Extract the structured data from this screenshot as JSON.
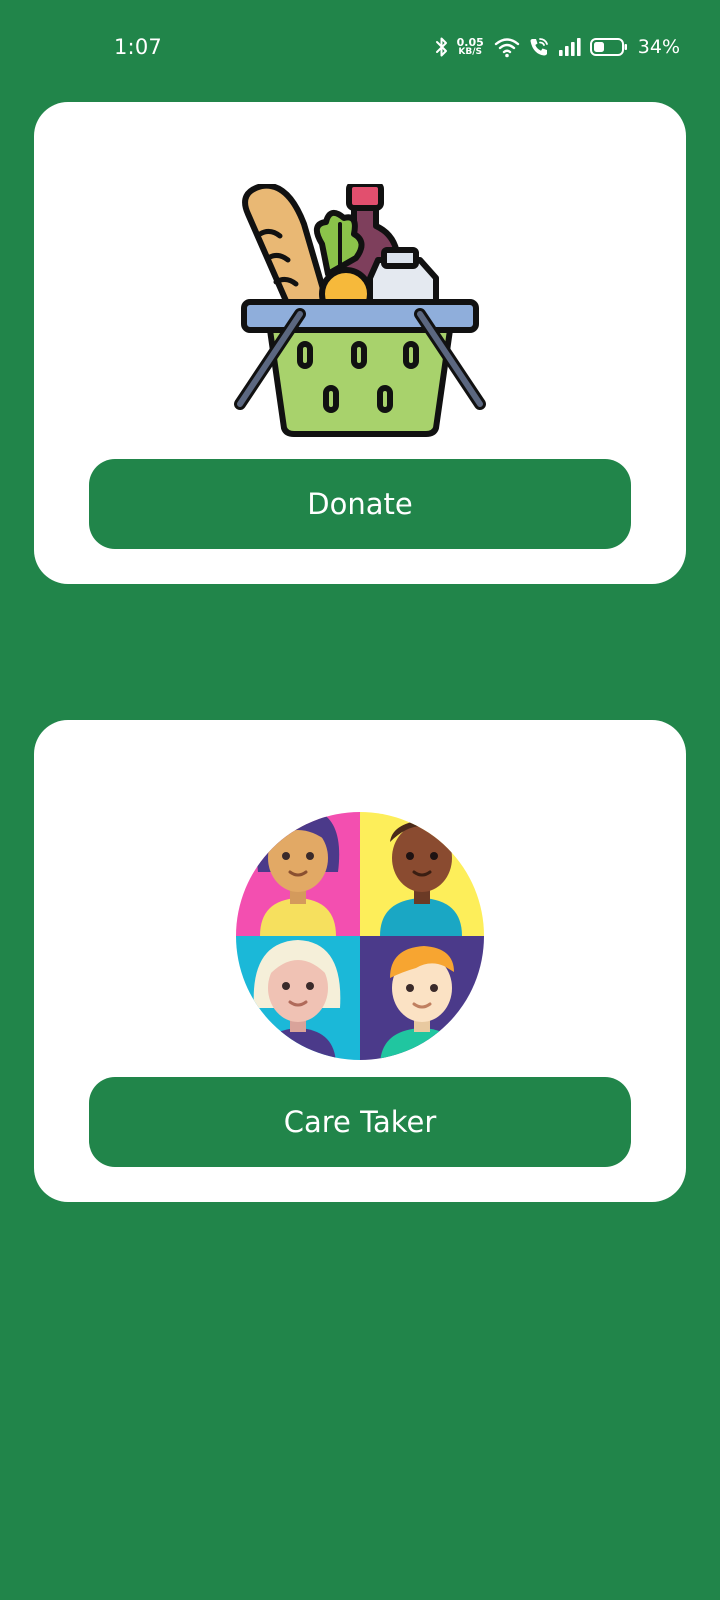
{
  "status_bar": {
    "time": "1:07",
    "net_speed_value": "0.05",
    "net_speed_unit": "KB/S",
    "battery_percent": "34%",
    "icons": [
      "bluetooth-icon",
      "wifi-icon",
      "wifi-call-icon",
      "signal-icon",
      "battery-icon"
    ]
  },
  "theme": {
    "background": "#21854A",
    "card": "#FFFFFF",
    "button": "#21854A",
    "button_text": "#FFFFFF"
  },
  "cards": {
    "donate": {
      "illustration": "grocery-basket-icon",
      "button_label": "Donate"
    },
    "caretaker": {
      "illustration": "people-group-icon",
      "button_label": "Care Taker"
    }
  }
}
